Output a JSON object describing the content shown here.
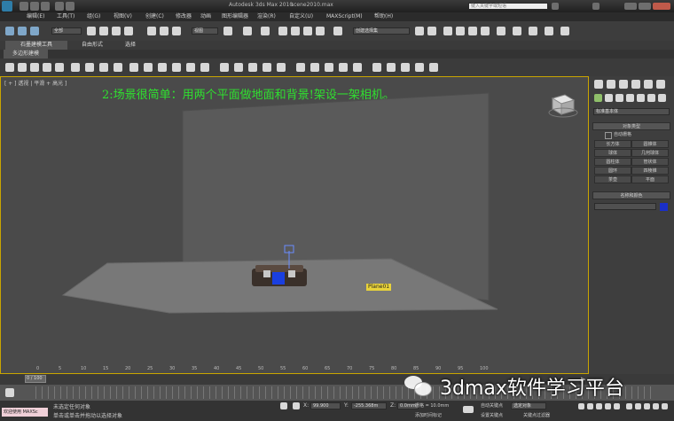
{
  "window": {
    "title": "Autodesk 3ds Max 2010",
    "file": "scene2010.max",
    "search_placeholder": "键入关键字或短语"
  },
  "menu": {
    "items": [
      "编辑(E)",
      "工具(T)",
      "组(G)",
      "视图(V)",
      "创建(C)",
      "修改器",
      "动画",
      "图形编辑器",
      "渲染(R)",
      "自定义(U)",
      "MAXScript(M)",
      "帮助(H)"
    ]
  },
  "toolbar": {
    "selection_filter": "全部",
    "ref_coord": "视图",
    "named_selection": "创建选择集"
  },
  "ribbon": {
    "tabs": [
      "石墨建模工具",
      "自由形式",
      "选择"
    ],
    "subpanel": "多边形建模"
  },
  "viewport": {
    "label": "[ + ] 透视 | 平滑 + 高光 ]",
    "annotation": "2:场景很简单：用两个平面做地面和背景!架设一架相机。",
    "object_label": "Plane01",
    "ruler_ticks": [
      "0",
      "5",
      "10",
      "15",
      "20",
      "25",
      "30",
      "35",
      "40",
      "45",
      "50",
      "55",
      "60",
      "65",
      "70",
      "75",
      "80",
      "85",
      "90",
      "95",
      "100"
    ]
  },
  "panel": {
    "dropdown": "标准基本体",
    "section_object_type": "对象类型",
    "autogrid": "自动栅格",
    "buttons": [
      "长方体",
      "圆锥体",
      "球体",
      "几何球体",
      "圆柱体",
      "管状体",
      "圆环",
      "四棱锥",
      "茶壶",
      "平面"
    ],
    "section_name_color": "名称和颜色",
    "object_color": "#1a2fc8"
  },
  "timeline": {
    "frame": "0 / 100"
  },
  "status": {
    "welcome": "欢迎使用 MAXSc",
    "line1": "未选定任何对象",
    "line2": "单击或单击并拖动以选择对象",
    "x_label": "X:",
    "x_value": "99.900",
    "y_label": "Y:",
    "y_value": "-255.368m",
    "z_label": "Z:",
    "z_value": "0.0mm",
    "grid": "栅格 = 10.0mm",
    "auto_key": "自动关键点",
    "selected": "选定对象",
    "set_key": "设置关键点",
    "key_filters": "关键点过滤器",
    "add_time_tag": "添加时间标记"
  },
  "watermark": {
    "text": "3dmax软件学习平台"
  }
}
